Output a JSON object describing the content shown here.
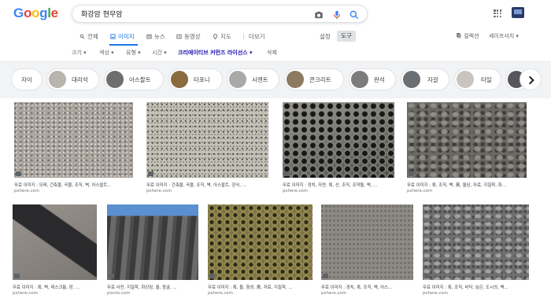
{
  "header": {
    "logo_letters": [
      {
        "ch": "G",
        "color": "#4285F4"
      },
      {
        "ch": "o",
        "color": "#EA4335"
      },
      {
        "ch": "o",
        "color": "#FBBC05"
      },
      {
        "ch": "g",
        "color": "#4285F4"
      },
      {
        "ch": "l",
        "color": "#34A853"
      },
      {
        "ch": "e",
        "color": "#EA4335"
      }
    ],
    "query": "화강암 현무암",
    "icons": {
      "camera": "camera-icon",
      "mic": "mic-icon",
      "search": "search-icon",
      "apps": "apps-grid-icon",
      "avatar": "account-avatar-icon"
    }
  },
  "tabs": [
    {
      "label": "전체",
      "icon": "search-icon",
      "active": false
    },
    {
      "label": "이미지",
      "icon": "image-icon",
      "active": true
    },
    {
      "label": "뉴스",
      "icon": "news-icon",
      "active": false
    },
    {
      "label": "동영상",
      "icon": "video-icon",
      "active": false
    },
    {
      "label": "지도",
      "icon": "map-pin-icon",
      "active": false
    },
    {
      "label": "⋮ 더보기",
      "icon": "",
      "active": false
    }
  ],
  "settings_label": "설정",
  "tools_label": "도구",
  "collections_label": "컬렉션",
  "safesearch_label": "세이프서치 ▾",
  "toolsbar": [
    {
      "label": "크기 ▾",
      "strong": false
    },
    {
      "label": "색상 ▾",
      "strong": false
    },
    {
      "label": "유형 ▾",
      "strong": false
    },
    {
      "label": "시간 ▾",
      "strong": false
    },
    {
      "label": "크리에이티브 커먼즈 라이선스 ▾",
      "strong": true
    },
    {
      "label": "삭제",
      "strong": false
    }
  ],
  "chips": [
    {
      "label": "자이",
      "color": ""
    },
    {
      "label": "대리석",
      "color": "#b8b4ae"
    },
    {
      "label": "아스팔트",
      "color": "#6e6e6e"
    },
    {
      "label": "타포니",
      "color": "#8a6a3f"
    },
    {
      "label": "시멘트",
      "color": "#a9a9a7"
    },
    {
      "label": "콘크리트",
      "color": "#8c7a62"
    },
    {
      "label": "판석",
      "color": "#7c7c7c"
    },
    {
      "label": "자갈",
      "color": "#6a6f73"
    },
    {
      "label": "타일",
      "color": "#c7c5bd"
    },
    {
      "label": "",
      "color": "#55575a"
    }
  ],
  "results_row1": [
    {
      "title": "무료 이미지 : 모래, 건축물, 곡물, 조직, 벽, 아스팔트...",
      "source": "pxhere.com",
      "color": "#a9a29c"
    },
    {
      "title": "무료 이미지 : 건축물, 곡물, 조직, 벽, 아스팔트, 장식, ...",
      "source": "pxhere.com",
      "color": "#c4c2b8"
    },
    {
      "title": "무료 이미지 : 경치, 자연, 록, 산, 조직, 조약돌, 벽, ...",
      "source": "pxhere.com",
      "color": "#4a4a46"
    },
    {
      "title": "무료 이미지 : 록, 조직, 벽, 黃, 돌담, 자료, 지질학, 화...",
      "source": "pxhere.com",
      "color": "#6a6964"
    }
  ],
  "results_row2": [
    {
      "title": "무료 이미지 : 록, 벽, 테스크톱, 판, ...",
      "source": "pxhere.com",
      "color": "#7a7672"
    },
    {
      "title": "무료 사진: 지질학, 화강암, 돌, 동굴, ...",
      "source": "pionio.com",
      "color": "#5a5b5a"
    },
    {
      "title": "무료 이미지 : 록, 돌, 형성, 黃, 자료, 지질학, ...",
      "source": "pxhere.com",
      "color": "#7d7344"
    },
    {
      "title": "무료 이미지 : 경치, 록, 조직, 벽, 아스...",
      "source": "pxhere.com",
      "color": "#8d8a86"
    },
    {
      "title": "무료 이미지 : 록, 조직, 바닥, 늪은, 도시의, 벽...",
      "source": "pxhere.com",
      "color": "#707072"
    }
  ]
}
